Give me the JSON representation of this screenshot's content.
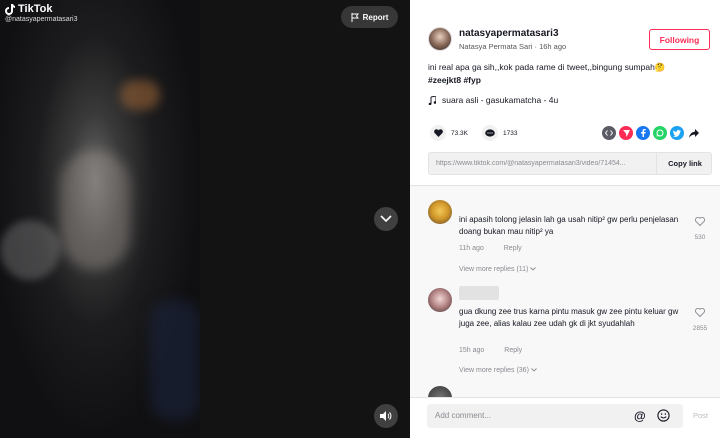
{
  "video": {
    "brand": "TikTok",
    "handle": "@natasyapermatasari3",
    "report_label": "Report"
  },
  "author": {
    "username": "natasyapermatasari3",
    "display_name": "Natasya Permata Sari",
    "time_ago": "16h ago",
    "follow_label": "Following"
  },
  "post": {
    "caption": "ini real apa ga sih,,kok pada rame di tweet,,bingung sumpah🤔",
    "hashtags": "#zeejkt8 #fyp",
    "music": "suara asli - gasukamatcha - 4u"
  },
  "stats": {
    "likes": "73.3K",
    "comments": "1733"
  },
  "share": {
    "link": "https://www.tiktok.com/@natasyapermatasari3/video/71454...",
    "copy_label": "Copy link"
  },
  "comments": [
    {
      "text": "ini apasih tolong jelasin lah ga usah nitip² gw perlu penjelasan doang bukan mau nitip² ya",
      "time": "11h ago",
      "reply_label": "Reply",
      "likes": "530",
      "view_replies": "View more replies (11)"
    },
    {
      "text": "gua dkung zee trus karna pintu masuk gw zee pintu keluar gw juga zee, alias kalau zee udah gk di jkt syudahlah",
      "time": "15h ago",
      "reply_label": "Reply",
      "likes": "2855",
      "view_replies": "View more replies (36)"
    }
  ],
  "comment_bar": {
    "placeholder": "Add comment...",
    "post_label": "Post"
  },
  "colors": {
    "accent": "#fe2c55",
    "text": "#161823",
    "muted": "#8a8b91"
  }
}
